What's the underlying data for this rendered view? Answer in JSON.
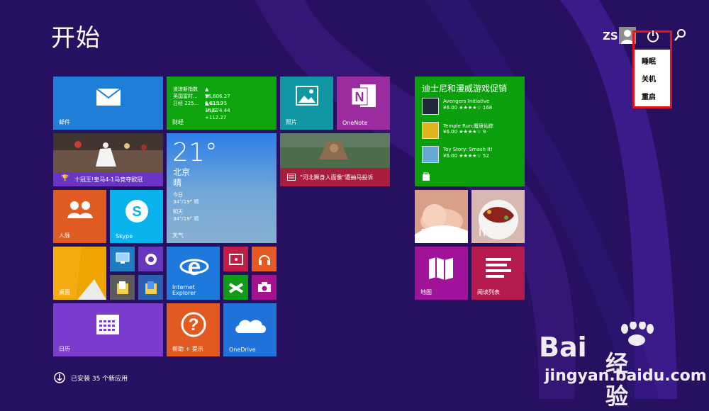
{
  "start": {
    "title": "开始",
    "user_initials": "ZS",
    "power_menu": [
      "睡眠",
      "关机",
      "重启"
    ]
  },
  "tiles": {
    "mail": "邮件",
    "finance": {
      "label": "财经",
      "rows": [
        {
          "name": "道琼斯指数",
          "value": "▲ 16,606.27 +63.19"
        },
        {
          "name": "英国富时...",
          "value": "▼ 6,815.75 -4.81"
        },
        {
          "name": "日经 225...",
          "value": "▲ 14,574.44 +112.27"
        }
      ]
    },
    "photos": "照片",
    "onenote": "OneNote",
    "sports_caption": "十冠王!皇马4-1马竞夺欧冠",
    "weather": {
      "temp": "21°",
      "city": "北京",
      "condition": "晴",
      "today_label": "今日",
      "today_value": "34°/19° 晴",
      "tomorrow_label": "明天",
      "tomorrow_value": "34°/19° 晴",
      "label": "天气"
    },
    "news_caption": "\"河北狮身人面像\"遭抽马投诉",
    "people": "人脉",
    "skype": "Skype",
    "desktop": "桌面",
    "ie": "Internet Explorer",
    "calendar": "日历",
    "help": "帮助 + 提示",
    "onedrive": "OneDrive",
    "store": {
      "title": "迪士尼和漫威游戏促销",
      "apps": [
        {
          "name": "Avengers Initiative",
          "price": "¥6.00 ★★★★☆ 168"
        },
        {
          "name": "Temple Run:魔境仙踪",
          "price": "¥6.00 ★★★★☆ 9"
        },
        {
          "name": "Toy Story: Smash It!",
          "price": "¥6.00 ★★★★☆ 52"
        }
      ]
    },
    "maps": "地图",
    "reading_list": "阅读列表"
  },
  "footer": {
    "installed": "已安装 35 个新应用"
  },
  "watermark": {
    "brand": "Bai",
    "brand_suffix": "经验",
    "url": "jingyan.baidu.com"
  },
  "colors": {
    "background": "#26105f",
    "mail": "#1e7ed8",
    "finance": "#0da40d",
    "photos": "#0f97a3",
    "onenote": "#9a2ca0",
    "people": "#df5b21",
    "skype": "#08b2ed",
    "desktop": "#e6a00a",
    "calendar": "#7a3bce",
    "help": "#e25a1f",
    "onedrive": "#1f72d7",
    "store": "#0b9f0d",
    "maps": "#a1129b",
    "reading": "#b51a4d",
    "highlight": "#e4141c"
  }
}
